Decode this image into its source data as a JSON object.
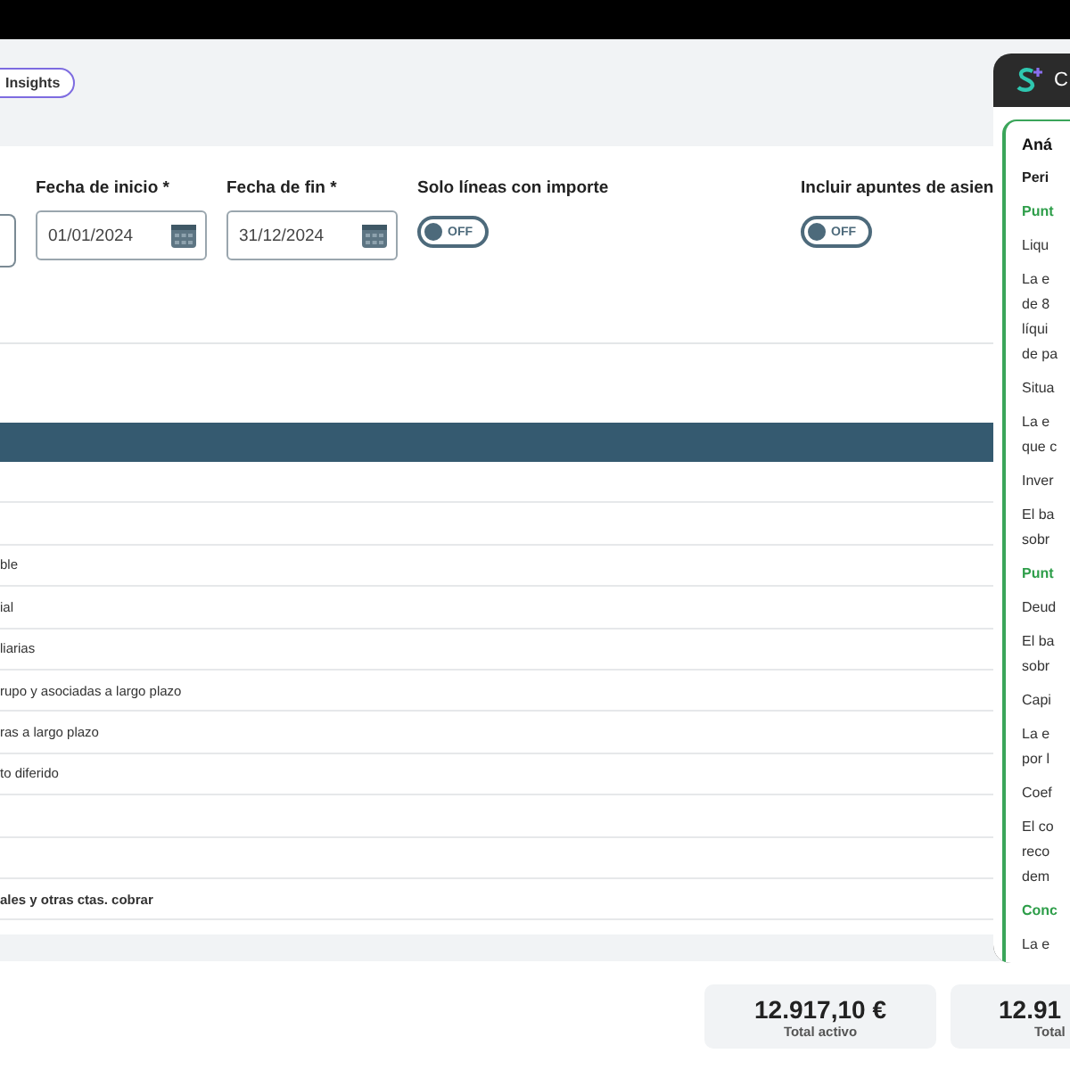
{
  "header": {
    "insights_button": "Insights"
  },
  "filters": [
    {
      "kind": "cut-field"
    },
    {
      "kind": "date",
      "label": "Fecha de inicio *",
      "value": "01/01/2024"
    },
    {
      "kind": "date",
      "label": "Fecha de fin *",
      "value": "31/12/2024"
    },
    {
      "kind": "toggle",
      "label": "Solo líneas con importe",
      "on": false,
      "state_text": "OFF"
    },
    {
      "kind": "toggle",
      "label": "Incluir apuntes de asien",
      "on": false,
      "state_text": "OFF"
    }
  ],
  "table": {
    "rows": [
      {},
      {},
      {
        "label": "ble",
        "bold": false
      },
      {
        "label": "ial",
        "bold": false
      },
      {
        "label": "liarias",
        "bold": false
      },
      {
        "label": "rupo y asociadas a largo plazo",
        "bold": false
      },
      {
        "label": "ras a largo plazo",
        "bold": false
      },
      {
        "label": "to diferido",
        "bold": false
      },
      {},
      {},
      {
        "label": "ales y otras ctas. cobrar",
        "bold": true
      }
    ]
  },
  "totals": [
    {
      "value": "12.917,10 €",
      "label": "Total activo"
    },
    {
      "value": "12.91",
      "label": "Total"
    }
  ],
  "assistant_panel": {
    "title": "C",
    "blocks": [
      {
        "kind": "title",
        "lines": [
          "Aná"
        ]
      },
      {
        "kind": "subtitle",
        "lines": [
          "Peri"
        ]
      },
      {
        "kind": "section",
        "lines": [
          "Punt"
        ]
      },
      {
        "kind": "text",
        "lines": [
          "Liqu"
        ]
      },
      {
        "kind": "text",
        "lines": [
          "La e",
          "de 8",
          "líqui",
          "de pa"
        ]
      },
      {
        "kind": "text",
        "lines": [
          "Situa"
        ]
      },
      {
        "kind": "text",
        "lines": [
          "La e",
          "que c"
        ]
      },
      {
        "kind": "text",
        "lines": [
          "Inver"
        ]
      },
      {
        "kind": "text",
        "lines": [
          "El ba",
          "sobr"
        ]
      },
      {
        "kind": "section",
        "lines": [
          "Punt"
        ]
      },
      {
        "kind": "text",
        "lines": [
          "Deud"
        ]
      },
      {
        "kind": "text",
        "lines": [
          "El ba",
          "sobr"
        ]
      },
      {
        "kind": "text",
        "lines": [
          "Capi"
        ]
      },
      {
        "kind": "text",
        "lines": [
          "La e",
          "por l"
        ]
      },
      {
        "kind": "text",
        "lines": [
          "Coef"
        ]
      },
      {
        "kind": "text",
        "lines": [
          "El co",
          "reco",
          "dem"
        ]
      },
      {
        "kind": "section",
        "lines": [
          "Conc"
        ]
      },
      {
        "kind": "text",
        "lines": [
          "La e"
        ]
      }
    ]
  }
}
